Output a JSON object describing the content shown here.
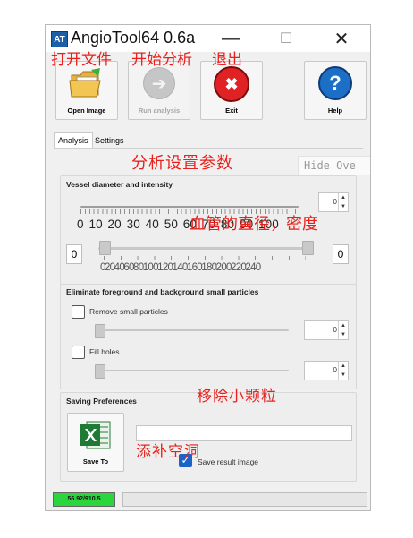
{
  "window": {
    "title": "AngioTool64 0.6a",
    "app_icon_text": "AT"
  },
  "titlebar": {
    "minimize": "—",
    "maximize": "☐",
    "close": "✕"
  },
  "annotations": {
    "open_file": "打开文件",
    "start_analysis": "开始分析",
    "exit": "退出",
    "param_settings": "分析设置参数",
    "vessel_diameter_density": "血管的直径，密度",
    "remove_particles": "移除小颗粒",
    "fill_holes": "添补空洞"
  },
  "toolbar": {
    "open_label": "Open Image",
    "run_label": "Run analysis",
    "exit_label": "Exit",
    "help_label": "Help",
    "help_glyph": "?",
    "exit_glyph": "✖",
    "run_glyph": "➔"
  },
  "tabs": [
    {
      "label": "Analysis"
    },
    {
      "label": "Settings"
    }
  ],
  "hide_overlay": "Hide Ove",
  "vessel": {
    "title": "Vessel diameter and intensity",
    "spinner_value": "0",
    "diameter_scale": "0 10 20 30 40 50 60 70 80 90 100",
    "intensity_left": "0",
    "intensity_right": "0",
    "intensity_scale": "0 20 40 60 80 100 120 140 160 180 200 220 240"
  },
  "particles": {
    "title": "Eliminate foreground and background small particles",
    "remove_label": "Remove small particles",
    "remove_value": "0",
    "fill_label": "Fill holes",
    "fill_value": "0"
  },
  "saving": {
    "title": "Saving Preferences",
    "save_to_label": "Save To",
    "save_result_label": "Save result image",
    "save_result_checked": true,
    "path_value": ""
  },
  "status": {
    "memory": "56.92/910.5"
  }
}
